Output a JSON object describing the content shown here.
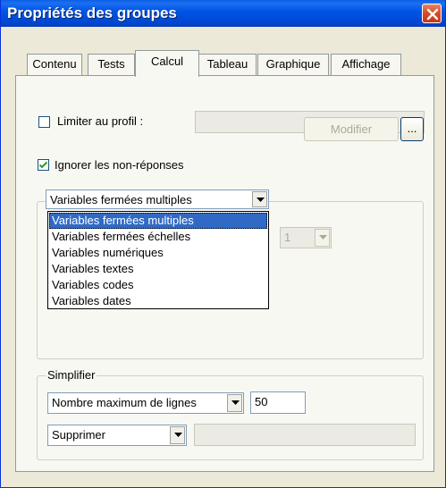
{
  "window": {
    "title": "Propriétés des groupes"
  },
  "tabs": [
    {
      "label": "Contenu"
    },
    {
      "label": "Tests"
    },
    {
      "label": "Calcul"
    },
    {
      "label": "Tableau"
    },
    {
      "label": "Graphique"
    },
    {
      "label": "Affichage"
    }
  ],
  "active_tab": "Calcul",
  "profile": {
    "label": "Limiter au profil :",
    "checked": false,
    "value": "",
    "modify_label": "Modifier",
    "browse_label": "..."
  },
  "ignore_nonresponses": {
    "label": "Ignorer les non-réponses",
    "checked": true
  },
  "variable_type": {
    "selected": "Variables fermées multiples",
    "options": [
      "Variables fermées multiples",
      "Variables fermées échelles",
      "Variables numériques",
      "Variables textes",
      "Variables codes",
      "Variables dates"
    ],
    "small_select_value": "1"
  },
  "simplify": {
    "legend": "Simplifier",
    "mode_selected": "Nombre maximum de lignes",
    "max_lines_value": "50",
    "action_selected": "Supprimer",
    "action_extra_value": ""
  }
}
